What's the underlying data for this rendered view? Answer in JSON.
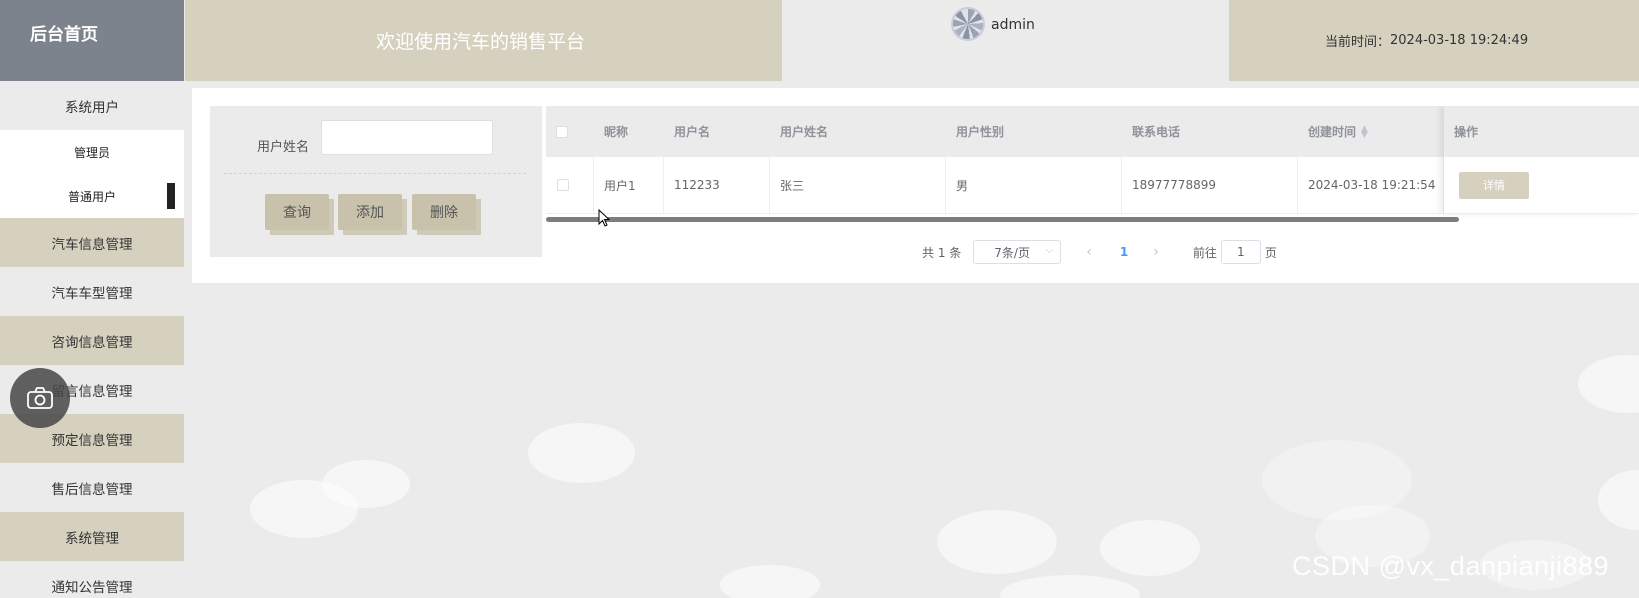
{
  "header": {
    "brand": "后台首页",
    "title": "欢迎使用汽车的销售平台",
    "username": "admin",
    "time_label": "当前时间：",
    "time_value": "2024-03-18 19:24:49"
  },
  "sidebar": {
    "items": [
      {
        "label": "系统用户"
      },
      {
        "label": "管理员"
      },
      {
        "label": "普通用户"
      },
      {
        "label": "汽车信息管理"
      },
      {
        "label": "汽车车型管理"
      },
      {
        "label": "咨询信息管理"
      },
      {
        "label": "留言信息管理"
      },
      {
        "label": "预定信息管理"
      },
      {
        "label": "售后信息管理"
      },
      {
        "label": "系统管理"
      },
      {
        "label": "通知公告管理"
      }
    ]
  },
  "search": {
    "label": "用户姓名",
    "value": "",
    "buttons": {
      "query": "查询",
      "add": "添加",
      "delete": "删除"
    }
  },
  "table": {
    "columns": [
      "昵称",
      "用户名",
      "用户姓名",
      "用户性别",
      "联系电话",
      "创建时间",
      "操作"
    ],
    "rows": [
      {
        "nickname": "用户1",
        "username": "112233",
        "realname": "张三",
        "gender": "男",
        "phone": "18977778899",
        "created": "2024-03-18 19:21:54",
        "action": "详情"
      }
    ]
  },
  "pagination": {
    "total": "共 1 条",
    "page_size": "7条/页",
    "current_page": "1",
    "goto_label": "前往",
    "goto_value": "1",
    "page_unit": "页"
  },
  "watermark": "CSDN @vx_danpianji889"
}
